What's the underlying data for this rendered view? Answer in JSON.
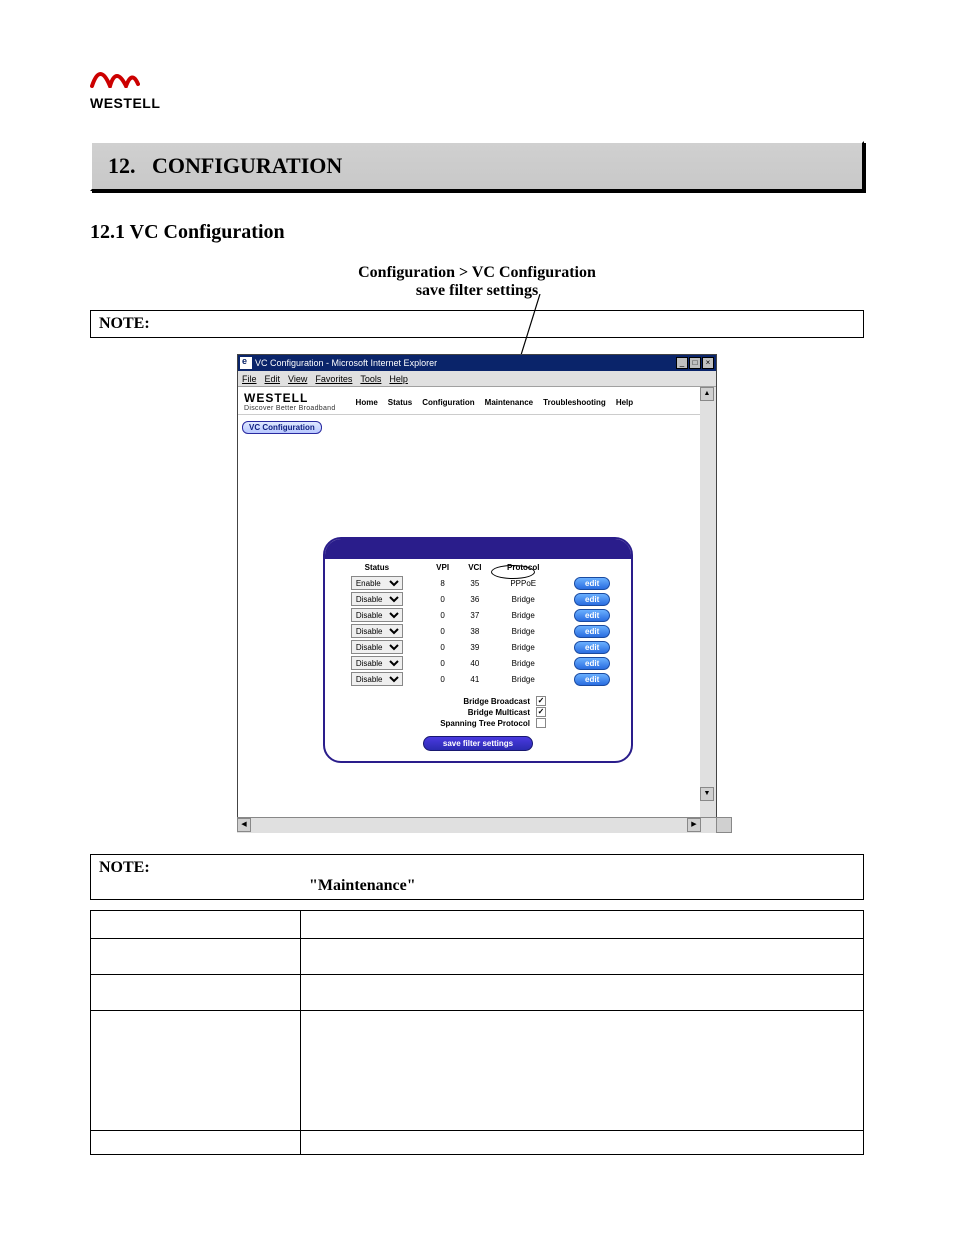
{
  "logo": {
    "brand": "WESTELL"
  },
  "section": {
    "number": "12.",
    "title": "CONFIGURATION"
  },
  "subsection": {
    "number": "12.1",
    "title": "VC Configuration"
  },
  "breadcrumb": {
    "path": "Configuration > VC Configuration",
    "sub": "save filter settings"
  },
  "note1_label": "NOTE:",
  "note2_label": "NOTE:",
  "note2_emph": "\"Maintenance\"",
  "browser": {
    "title": "VC Configuration - Microsoft Internet Explorer",
    "menu": [
      "File",
      "Edit",
      "View",
      "Favorites",
      "Tools",
      "Help"
    ],
    "brand_big": "WESTELL",
    "brand_tag": "Discover Better Broadband",
    "topnav": [
      "Home",
      "Status",
      "Configuration",
      "Maintenance",
      "Troubleshooting",
      "Help"
    ],
    "side_button": "VC Configuration"
  },
  "vc": {
    "headers": [
      "Status",
      "VPI",
      "VCI",
      "Protocol",
      ""
    ],
    "rows": [
      {
        "status": "Enable",
        "vpi": "8",
        "vci": "35",
        "protocol": "PPPoE",
        "edit": "edit"
      },
      {
        "status": "Disable",
        "vpi": "0",
        "vci": "36",
        "protocol": "Bridge",
        "edit": "edit"
      },
      {
        "status": "Disable",
        "vpi": "0",
        "vci": "37",
        "protocol": "Bridge",
        "edit": "edit"
      },
      {
        "status": "Disable",
        "vpi": "0",
        "vci": "38",
        "protocol": "Bridge",
        "edit": "edit"
      },
      {
        "status": "Disable",
        "vpi": "0",
        "vci": "39",
        "protocol": "Bridge",
        "edit": "edit"
      },
      {
        "status": "Disable",
        "vpi": "0",
        "vci": "40",
        "protocol": "Bridge",
        "edit": "edit"
      },
      {
        "status": "Disable",
        "vpi": "0",
        "vci": "41",
        "protocol": "Bridge",
        "edit": "edit"
      }
    ],
    "opts": {
      "bb_label": "Bridge Broadcast",
      "bb_checked": true,
      "bm_label": "Bridge Multicast",
      "bm_checked": true,
      "stp_label": "Spanning Tree Protocol",
      "stp_checked": false
    },
    "save": "save filter settings"
  },
  "def_table": {
    "rows": [
      {
        "k": "",
        "v": ""
      },
      {
        "k": "",
        "v": ""
      },
      {
        "k": "",
        "v": ""
      },
      {
        "k": "",
        "v": ""
      },
      {
        "k": "",
        "v": ""
      }
    ]
  }
}
